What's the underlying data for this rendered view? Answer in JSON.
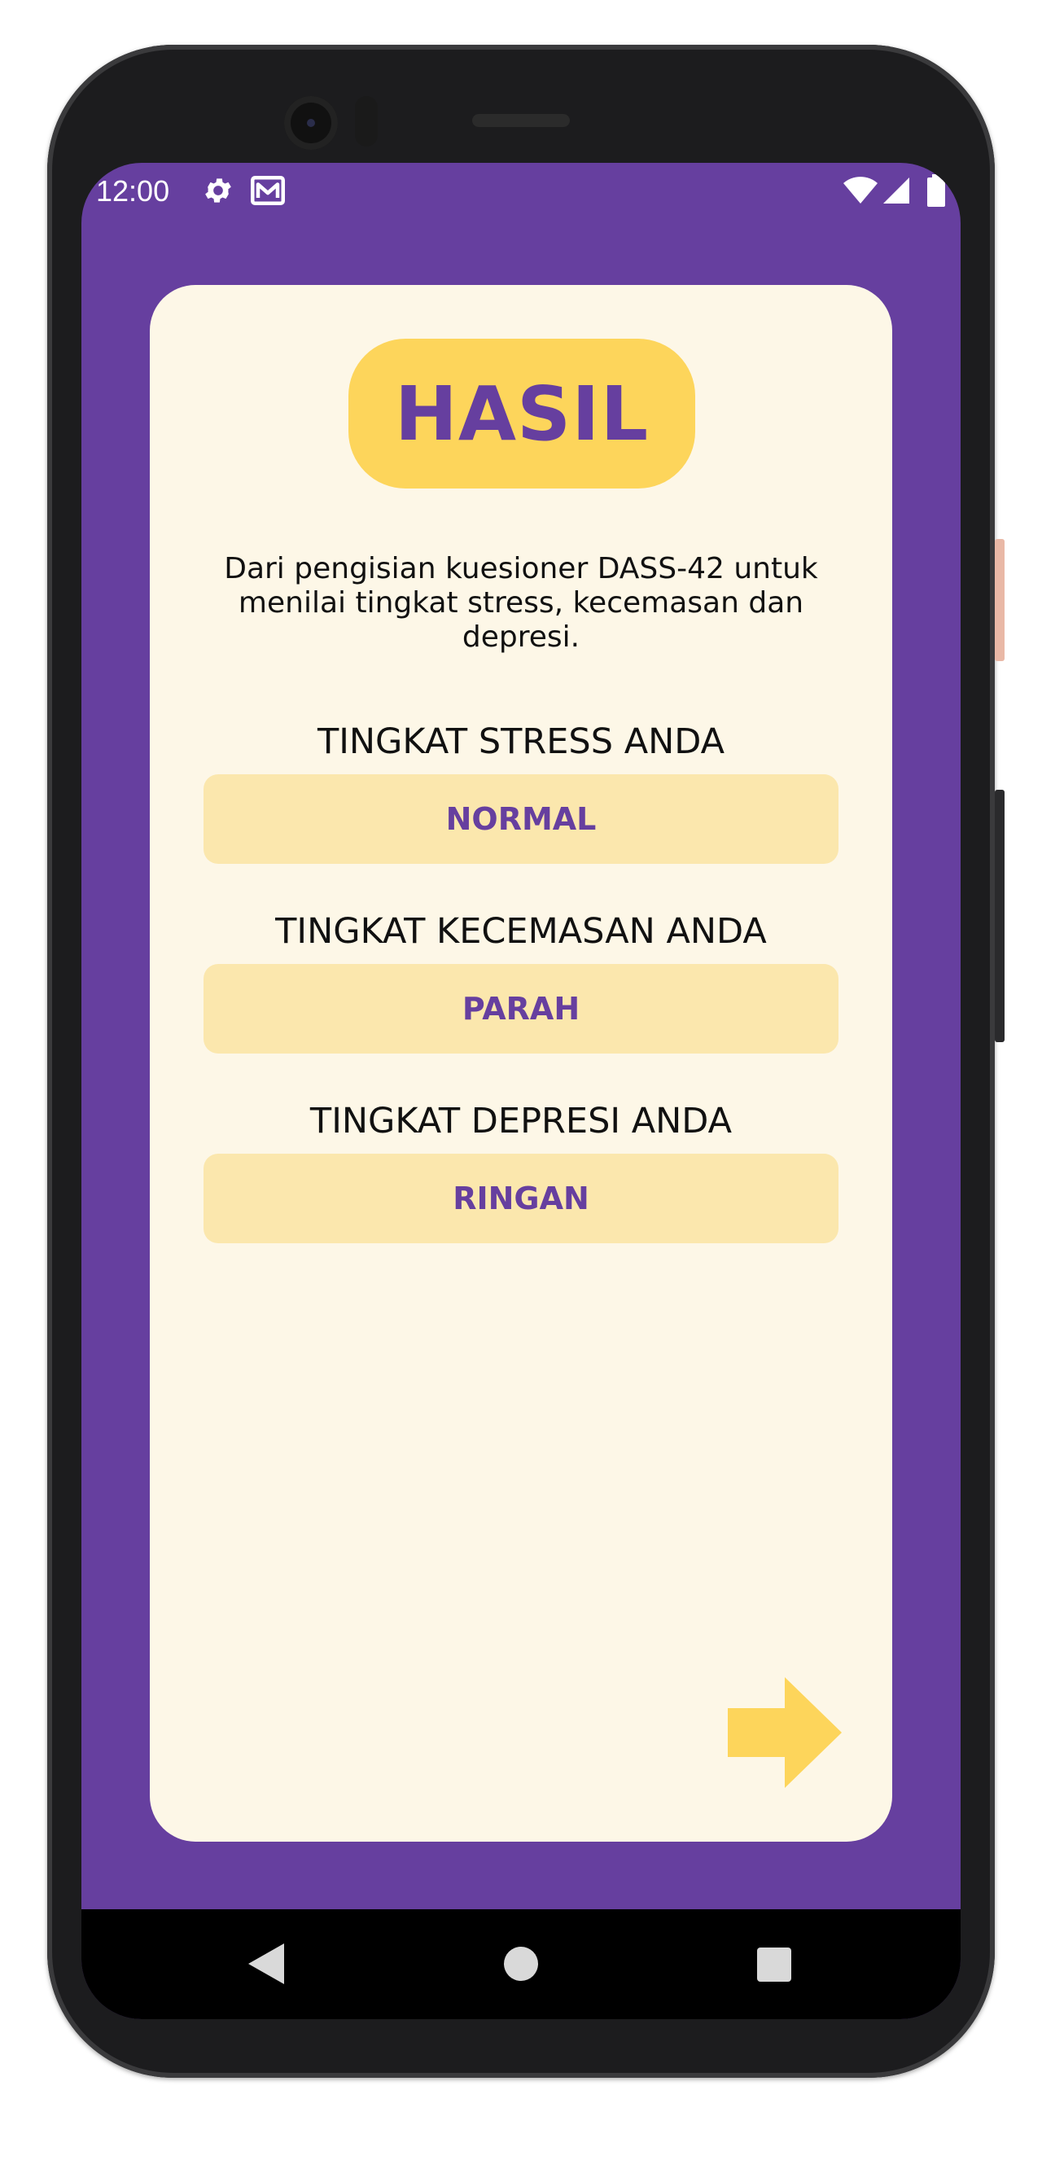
{
  "status_bar": {
    "time": "12:00",
    "icons": [
      "gear-icon",
      "mail-icon",
      "wifi-icon",
      "signal-icon",
      "battery-icon"
    ]
  },
  "result_screen": {
    "title": "HASIL",
    "intro": "Dari pengisian kuesioner DASS-42 untuk menilai tingkat stress, kecemasan dan depresi.",
    "results": [
      {
        "label": "TINGKAT STRESS ANDA",
        "value": "NORMAL"
      },
      {
        "label": "TINGKAT KECEMASAN ANDA",
        "value": "PARAH"
      },
      {
        "label": "TINGKAT DEPRESI ANDA",
        "value": "RINGAN"
      }
    ],
    "next_icon": "arrow-right-icon"
  },
  "nav_bar": {
    "icons": [
      "back-icon",
      "home-icon",
      "recents-icon"
    ]
  },
  "colors": {
    "primary_purple": "#663f9f",
    "accent_yellow": "#fdd55b",
    "card_background": "#fdf7e7",
    "result_box": "#fbe7ad"
  }
}
